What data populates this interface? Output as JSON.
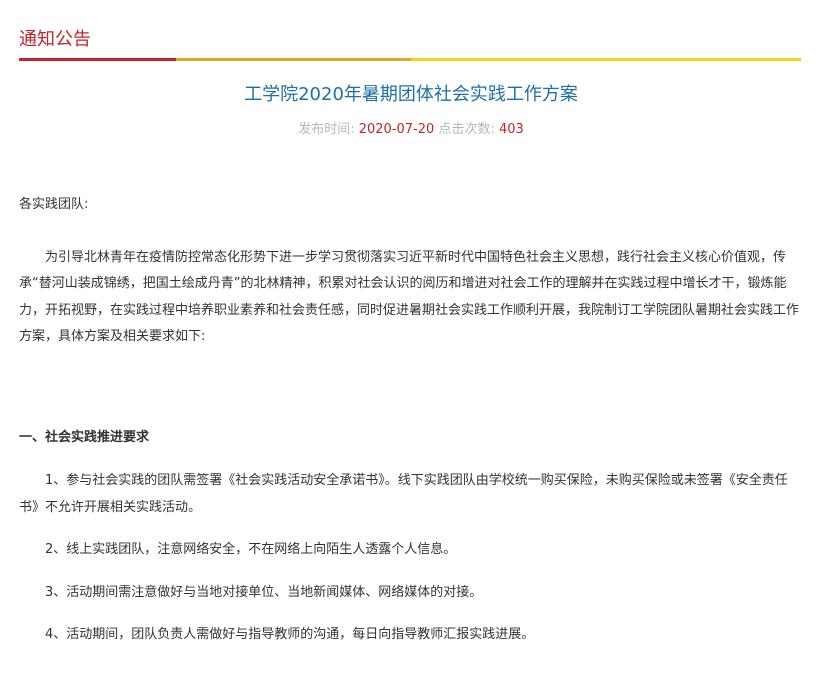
{
  "colors": {
    "accent_red": "#c0252b",
    "bar_red": "#c8232c",
    "bar_orange": "#e3a530",
    "bar_yellow": "#f7d117",
    "title_blue": "#1e6fa8",
    "meta_gray": "#b7b7b7",
    "body_text": "#333333"
  },
  "section": {
    "title": "通知公告"
  },
  "article": {
    "title": "工学院2020年暑期团体社会实践工作方案",
    "meta": {
      "publish_label": "发布时间:",
      "publish_date": "2020-07-20",
      "views_label": "点击次数:",
      "views_count": "403"
    },
    "greeting": "各实践团队:",
    "intro": "为引导北林青年在疫情防控常态化形势下进一步学习贯彻落实习近平新时代中国特色社会主义思想，践行社会主义核心价值观，传承“替河山装成锦绣，把国土绘成丹青”的北林精神，积累对社会认识的阅历和增进对社会工作的理解并在实践过程中增长才干，锻炼能力，开拓视野，在实践过程中培养职业素养和社会责任感，同时促进暑期社会实践工作顺利开展，我院制订工学院团队暑期社会实践工作方案，具体方案及相关要求如下:",
    "heading_1": "一、社会实践推进要求",
    "items": [
      "1、参与社会实践的团队需签署《社会实践活动安全承诺书》。线下实践团队由学校统一购买保险，未购买保险或未签署《安全责任书》不允许开展相关实践活动。",
      "2、线上实践团队，注意网络安全，不在网络上向陌生人透露个人信息。",
      "3、活动期间需注意做好与当地对接单位、当地新闻媒体、网络媒体的对接。",
      "4、活动期间，团队负责人需做好与指导教师的沟通，每日向指导教师汇报实践进展。"
    ]
  }
}
